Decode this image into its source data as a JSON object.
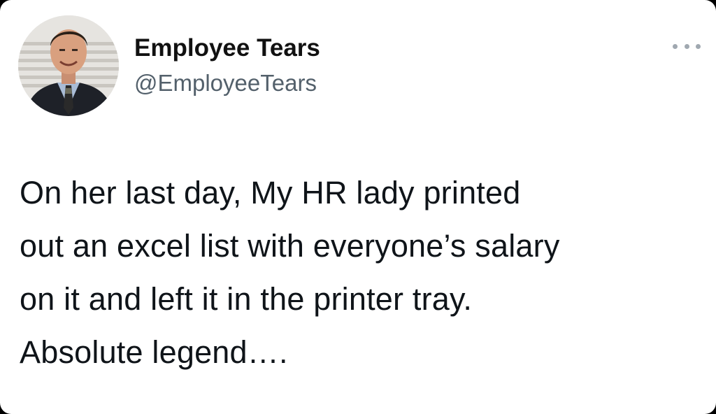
{
  "account": {
    "display_name": "Employee Tears",
    "handle": "@EmployeeTears",
    "avatar_icon": "profile-photo-man-in-suit"
  },
  "menu": {
    "icon": "more-options-ellipsis-icon"
  },
  "tweet": {
    "lines": [
      "On her last day, My HR lady printed",
      "out an excel list with everyone’s salary",
      "on it and left it in the printer tray.",
      "Absolute legend…."
    ]
  },
  "colors": {
    "background": "#ffffff",
    "name_text": "#111111",
    "handle_text": "#53606b",
    "body_text": "#0f1419",
    "ellipsis": "#a0a8b0"
  }
}
